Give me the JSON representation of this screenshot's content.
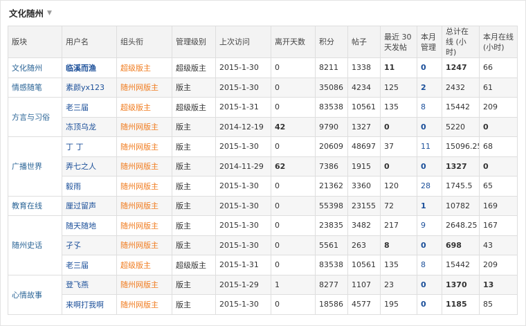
{
  "title": "文化随州",
  "headers": [
    "版块",
    "用户名",
    "组头衔",
    "管理级别",
    "上次访问",
    "离开天数",
    "积分",
    "帖子",
    "最近 30 天发帖",
    "本月管理",
    "总计在线 (小时)",
    "本月在线 (小时)"
  ],
  "rows": [
    {
      "block": "文化随州",
      "rowspan": 1,
      "user": "临溪而渔",
      "user_bold": true,
      "group": "超级版主",
      "level": "超级版主",
      "visit": "2015-1-30",
      "away": "0",
      "away_bold": false,
      "points": "8211",
      "posts": "1338",
      "recent": "11",
      "recent_bold": true,
      "month_mgmt": "0",
      "mgmt_bold": true,
      "total_online": "1247",
      "total_bold": true,
      "month_online": "66",
      "month_bold": false
    },
    {
      "block": "情感随笔",
      "rowspan": 1,
      "user": "素颜yx123",
      "user_bold": false,
      "group": "随州网版主",
      "level": "版主",
      "visit": "2015-1-30",
      "away": "0",
      "away_bold": false,
      "points": "35086",
      "posts": "4234",
      "recent": "125",
      "recent_bold": false,
      "month_mgmt": "2",
      "mgmt_bold": true,
      "total_online": "2432",
      "total_bold": false,
      "month_online": "61",
      "month_bold": false
    },
    {
      "block": "方言与习俗",
      "rowspan": 2,
      "user": "老三届",
      "user_bold": false,
      "group": "超级版主",
      "level": "超级版主",
      "visit": "2015-1-31",
      "away": "0",
      "away_bold": false,
      "points": "83538",
      "posts": "10561",
      "recent": "135",
      "recent_bold": false,
      "month_mgmt": "8",
      "mgmt_bold": false,
      "total_online": "15442",
      "total_bold": false,
      "month_online": "209",
      "month_bold": false
    },
    {
      "block": null,
      "user": "冻顶乌龙",
      "user_bold": false,
      "group": "随州网版主",
      "level": "版主",
      "visit": "2014-12-19",
      "away": "42",
      "away_bold": true,
      "points": "9790",
      "posts": "1327",
      "recent": "0",
      "recent_bold": true,
      "month_mgmt": "0",
      "mgmt_bold": true,
      "total_online": "5220",
      "total_bold": false,
      "month_online": "0",
      "month_bold": true
    },
    {
      "block": "广播世界",
      "rowspan": 3,
      "user": "丁 丁",
      "user_bold": false,
      "group": "随州网版主",
      "level": "版主",
      "visit": "2015-1-30",
      "away": "0",
      "away_bold": false,
      "points": "20609",
      "posts": "48697",
      "recent": "37",
      "recent_bold": false,
      "month_mgmt": "11",
      "mgmt_bold": false,
      "total_online": "15096.25",
      "total_bold": false,
      "month_online": "68",
      "month_bold": false
    },
    {
      "block": null,
      "user": "弄七之人",
      "user_bold": false,
      "group": "随州网版主",
      "level": "版主",
      "visit": "2014-11-29",
      "away": "62",
      "away_bold": true,
      "points": "7386",
      "posts": "1915",
      "recent": "0",
      "recent_bold": true,
      "month_mgmt": "0",
      "mgmt_bold": true,
      "total_online": "1327",
      "total_bold": true,
      "month_online": "0",
      "month_bold": true
    },
    {
      "block": null,
      "user": "毅雨",
      "user_bold": false,
      "group": "随州网版主",
      "level": "版主",
      "visit": "2015-1-30",
      "away": "0",
      "away_bold": false,
      "points": "21362",
      "posts": "3360",
      "recent": "120",
      "recent_bold": false,
      "month_mgmt": "28",
      "mgmt_bold": false,
      "total_online": "1745.5",
      "total_bold": false,
      "month_online": "65",
      "month_bold": false
    },
    {
      "block": "教育在线",
      "rowspan": 1,
      "user": "厘过留声",
      "user_bold": false,
      "group": "随州网版主",
      "level": "版主",
      "visit": "2015-1-30",
      "away": "0",
      "away_bold": false,
      "points": "55398",
      "posts": "23155",
      "recent": "72",
      "recent_bold": false,
      "month_mgmt": "1",
      "mgmt_bold": true,
      "total_online": "10782",
      "total_bold": false,
      "month_online": "169",
      "month_bold": false
    },
    {
      "block": "随州史话",
      "rowspan": 3,
      "user": "随天随地",
      "user_bold": false,
      "group": "随州网版主",
      "level": "版主",
      "visit": "2015-1-30",
      "away": "0",
      "away_bold": false,
      "points": "23835",
      "posts": "3482",
      "recent": "217",
      "recent_bold": false,
      "month_mgmt": "9",
      "mgmt_bold": false,
      "total_online": "2648.25",
      "total_bold": false,
      "month_online": "167",
      "month_bold": false
    },
    {
      "block": null,
      "user": "孑孓",
      "user_bold": false,
      "group": "随州网版主",
      "level": "版主",
      "visit": "2015-1-30",
      "away": "0",
      "away_bold": false,
      "points": "5561",
      "posts": "263",
      "recent": "8",
      "recent_bold": true,
      "month_mgmt": "0",
      "mgmt_bold": true,
      "total_online": "698",
      "total_bold": true,
      "month_online": "43",
      "month_bold": false
    },
    {
      "block": null,
      "user": "老三届",
      "user_bold": false,
      "group": "超级版主",
      "level": "超级版主",
      "visit": "2015-1-31",
      "away": "0",
      "away_bold": false,
      "points": "83538",
      "posts": "10561",
      "recent": "135",
      "recent_bold": false,
      "month_mgmt": "8",
      "mgmt_bold": false,
      "total_online": "15442",
      "total_bold": false,
      "month_online": "209",
      "month_bold": false
    },
    {
      "block": "心情故事",
      "rowspan": 2,
      "user": "登飞燕",
      "user_bold": false,
      "group": "随州网版主",
      "level": "版主",
      "visit": "2015-1-29",
      "away": "1",
      "away_bold": false,
      "points": "8277",
      "posts": "1107",
      "recent": "23",
      "recent_bold": false,
      "month_mgmt": "0",
      "mgmt_bold": true,
      "total_online": "1370",
      "total_bold": true,
      "month_online": "13",
      "month_bold": true
    },
    {
      "block": null,
      "user": "来啊打我啊",
      "user_bold": false,
      "group": "随州网版主",
      "level": "版主",
      "visit": "2015-1-30",
      "away": "0",
      "away_bold": false,
      "points": "18586",
      "posts": "4577",
      "recent": "195",
      "recent_bold": false,
      "month_mgmt": "0",
      "mgmt_bold": true,
      "total_online": "1185",
      "total_bold": true,
      "month_online": "85",
      "month_bold": false
    }
  ]
}
